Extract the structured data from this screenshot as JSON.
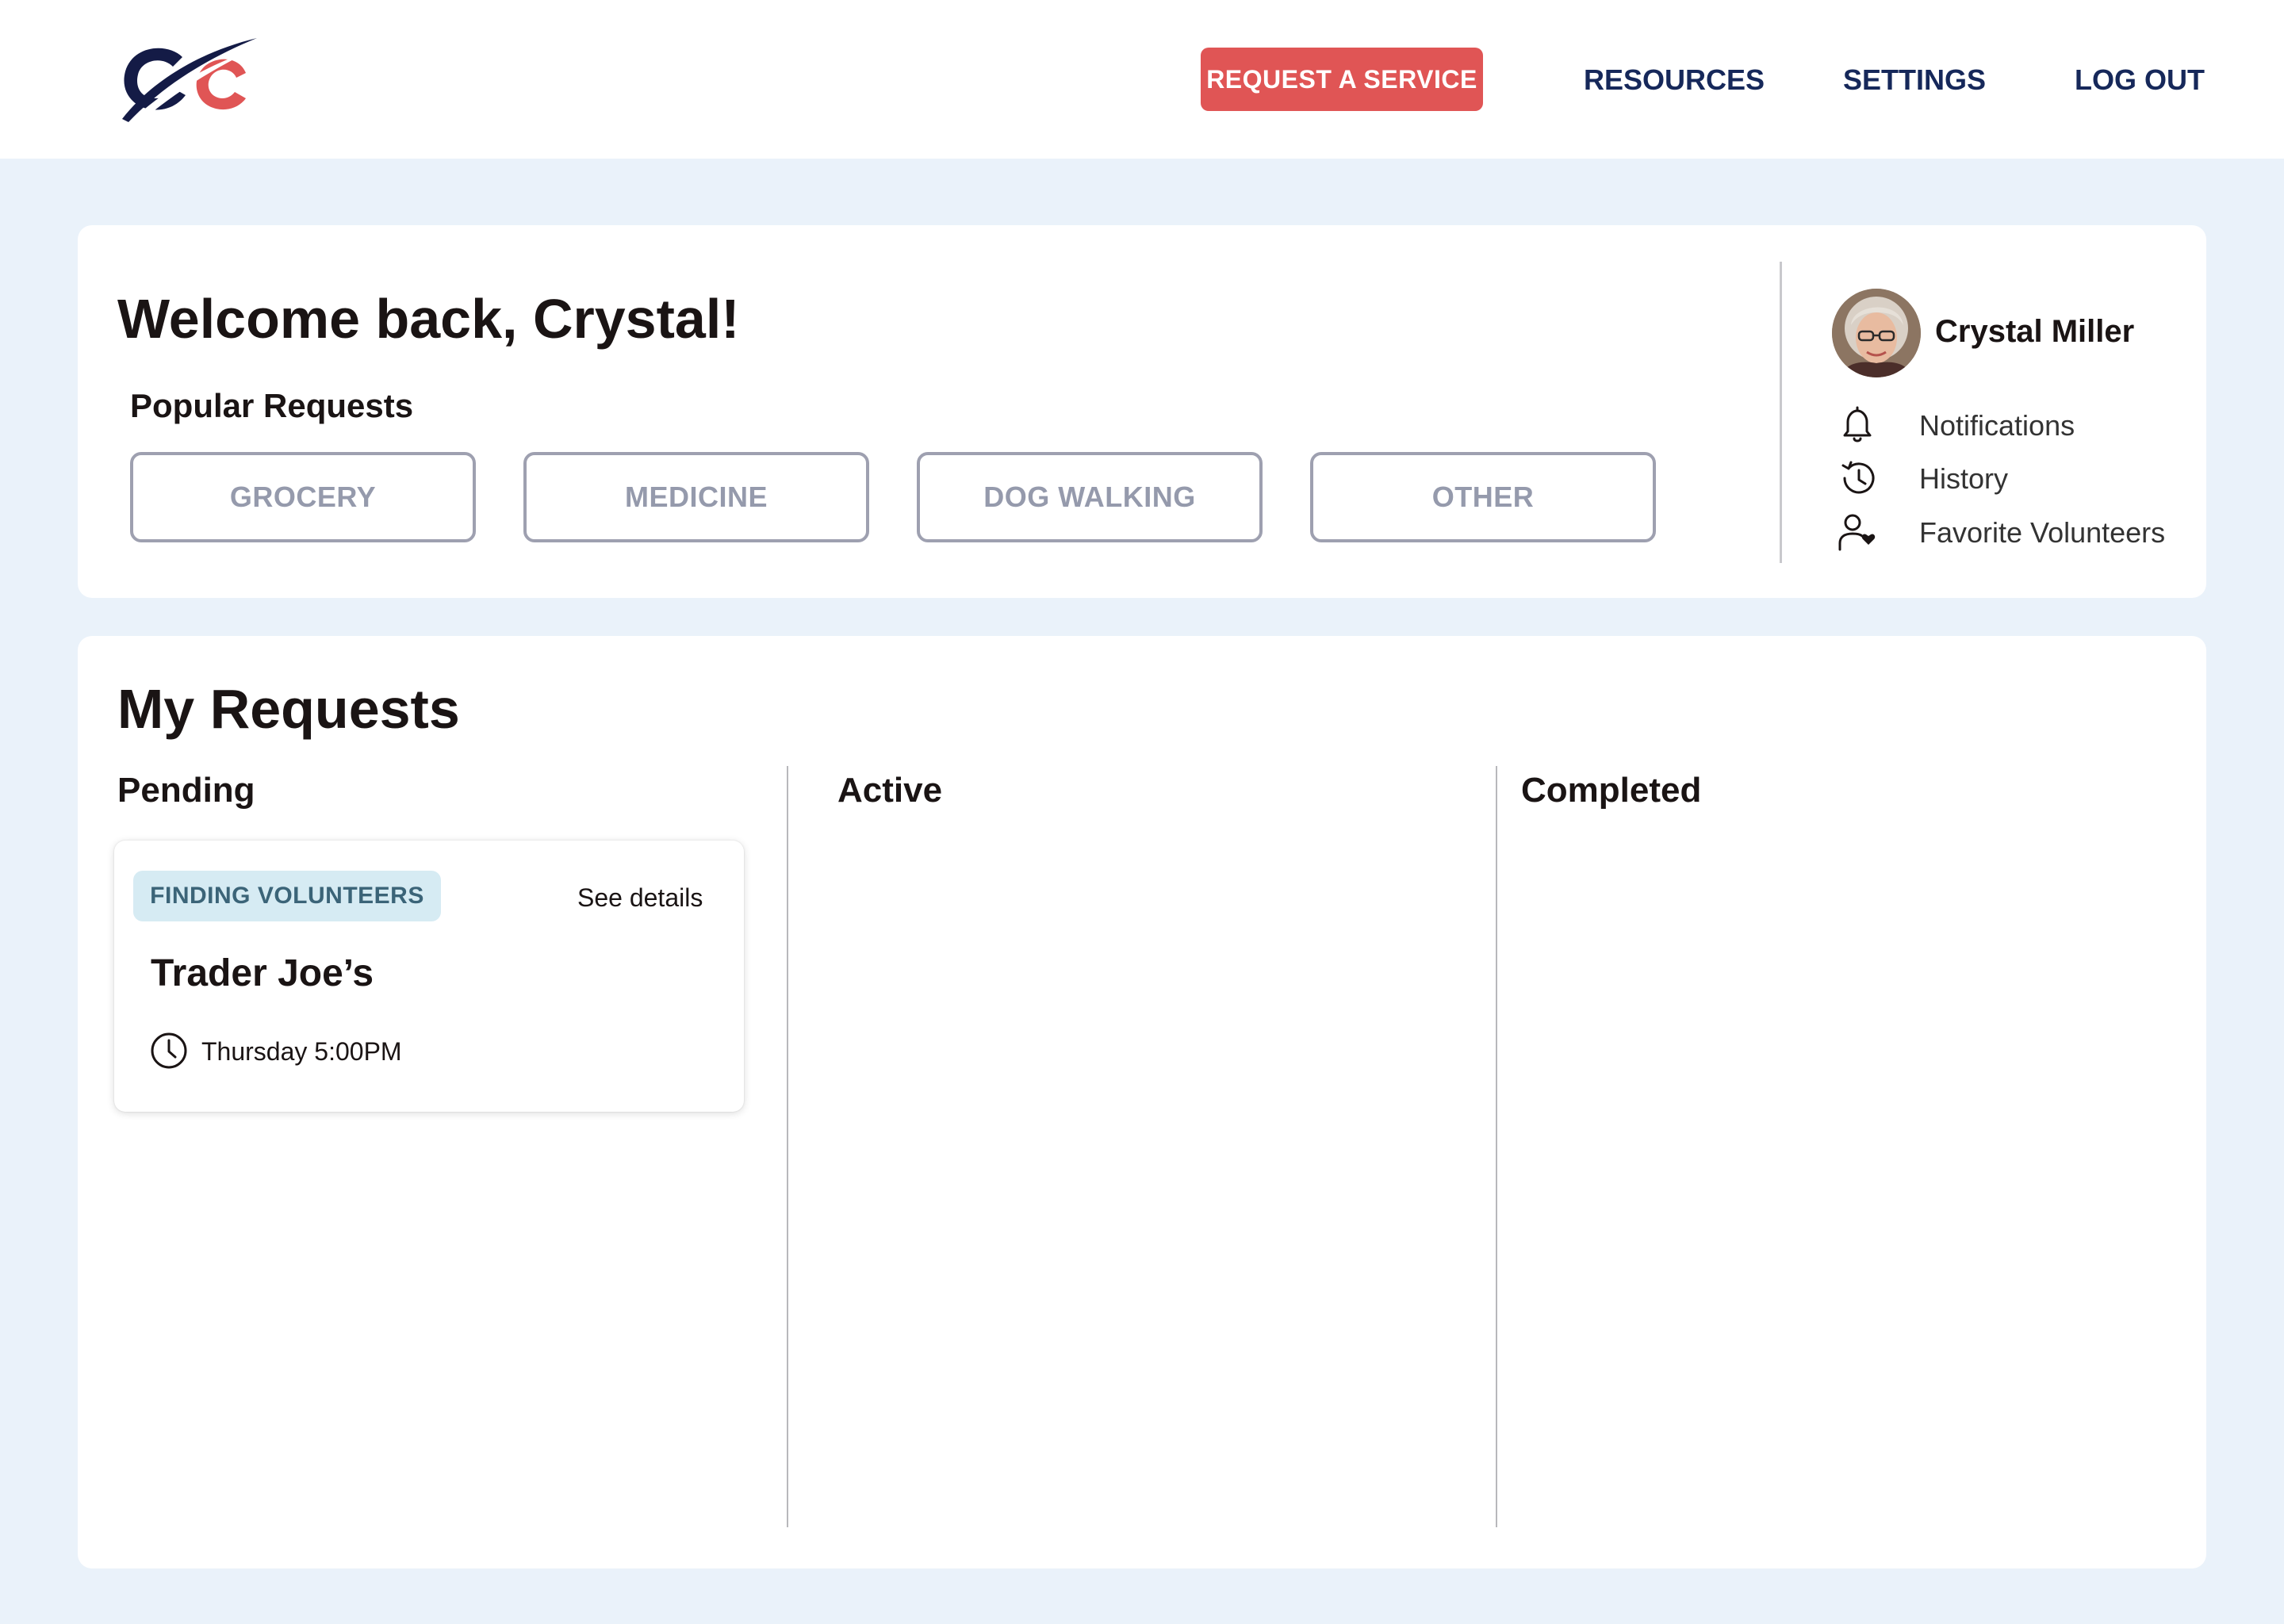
{
  "header": {
    "logo_icon": "cc-logo-icon",
    "request_button": "REQUEST A SERVICE",
    "nav": {
      "resources": "RESOURCES",
      "settings": "SETTINGS",
      "logout": "LOG OUT"
    }
  },
  "welcome": {
    "title": "Welcome back, Crystal!",
    "popular_title": "Popular Requests",
    "popular_items": [
      "GROCERY",
      "MEDICINE",
      "DOG WALKING",
      "OTHER"
    ]
  },
  "profile": {
    "name": "Crystal Miller",
    "menu": [
      {
        "label": "Notifications",
        "icon": "bell-icon"
      },
      {
        "label": "History",
        "icon": "history-icon"
      },
      {
        "label": "Favorite Volunteers",
        "icon": "favorite-user-icon"
      }
    ]
  },
  "requests": {
    "title": "My Requests",
    "columns": {
      "pending": "Pending",
      "active": "Active",
      "completed": "Completed"
    },
    "pending_items": [
      {
        "status": "FINDING VOLUNTEERS",
        "details_link": "See details",
        "title": "Trader Joe’s",
        "time": "Thursday 5:00PM",
        "time_icon": "clock-icon"
      }
    ]
  },
  "colors": {
    "accent_red": "#e05555",
    "navy": "#16285a",
    "page_bg": "#eaf2fa",
    "badge_bg": "#d6ebf3",
    "badge_text": "#3b6478",
    "pill_border": "#9ea0b0"
  }
}
